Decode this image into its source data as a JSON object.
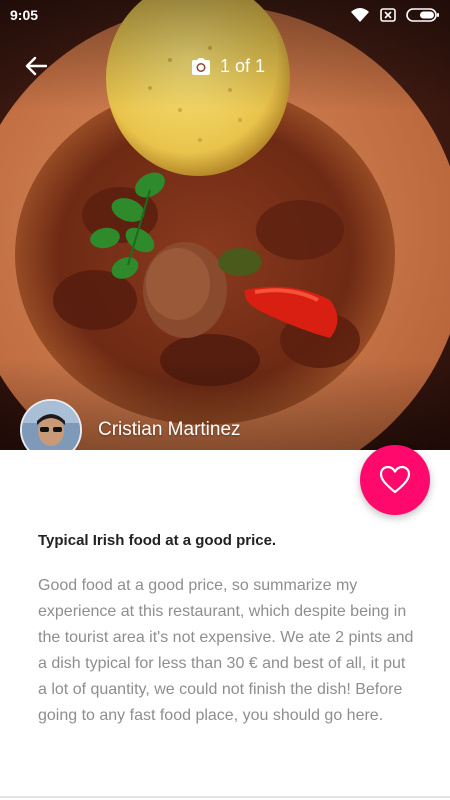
{
  "status_bar": {
    "time": "9:05",
    "icons": [
      "wifi-icon",
      "no-sim-icon",
      "battery-icon"
    ]
  },
  "header": {
    "back_icon": "arrow-left-icon",
    "camera_icon": "camera-icon",
    "photo_counter": "1 of 1"
  },
  "author": {
    "name": "Cristian Martinez"
  },
  "like_button": {
    "icon": "heart-outline-icon",
    "color": "#ff0a6c"
  },
  "review": {
    "title": "Typical Irish food at a good price.",
    "body": "Good food at a good price, so summarize my experience at this restaurant, which despite being in the tourist area it's not expensive. We ate 2 pints and a dish typical for less than 30 € and best of all, it put a lot of quantity, we could not finish the dish! Before going to any fast food place, you should go here."
  }
}
